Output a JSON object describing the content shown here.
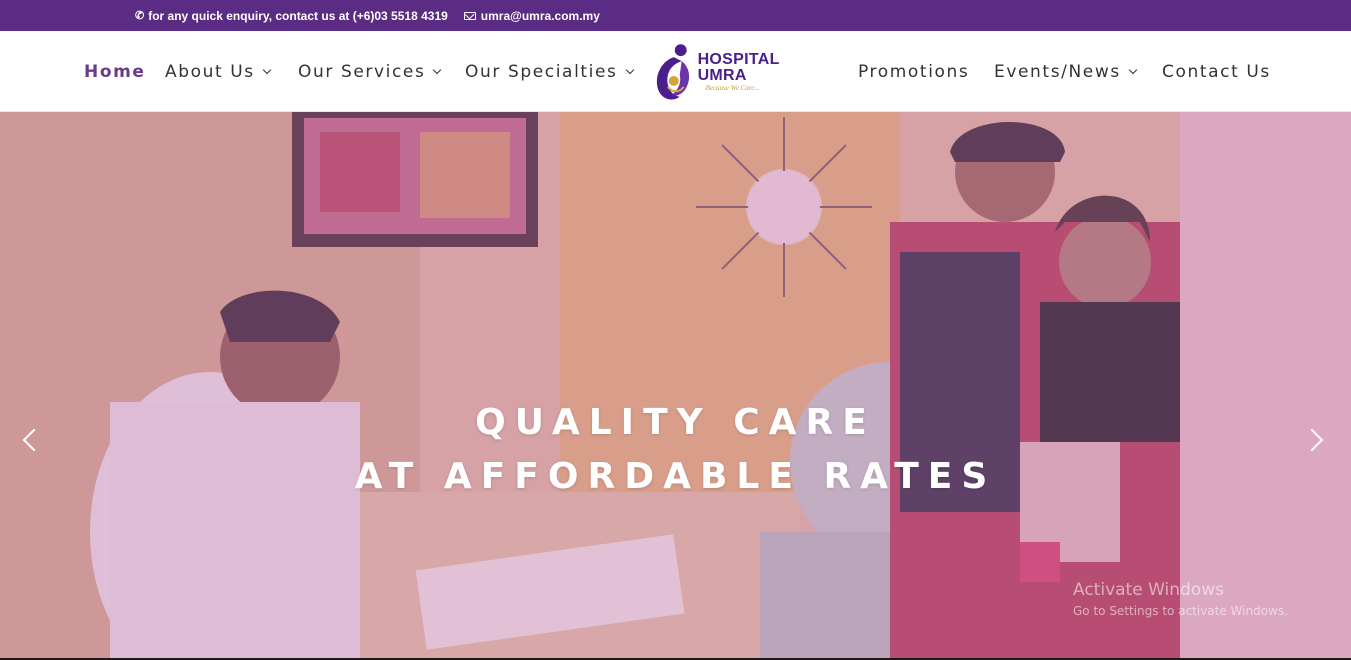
{
  "topbar": {
    "phone_text": "for any quick enquiry, contact us at (+6)03 5518 4319",
    "email_text": "umra@umra.com.my",
    "phone_icon": "phone-icon",
    "email_icon": "envelope-icon",
    "bg_color": "#5b2c83"
  },
  "nav": {
    "home": "Home",
    "about": "About Us",
    "services": "Our Services",
    "specialties": "Our Specialties",
    "promotions": "Promotions",
    "events": "Events/News",
    "contact": "Contact Us",
    "active_color": "#6d3a8a"
  },
  "logo": {
    "title": "HOSPITAL UMRA",
    "tagline": "Because We Care...",
    "brand_color": "#4a1e8c"
  },
  "hero": {
    "line1": "QUALITY CARE",
    "line2": "AT AFFORDABLE RATES"
  },
  "watermark": {
    "line1": "Activate Windows",
    "line2": "Go to Settings to activate Windows."
  }
}
